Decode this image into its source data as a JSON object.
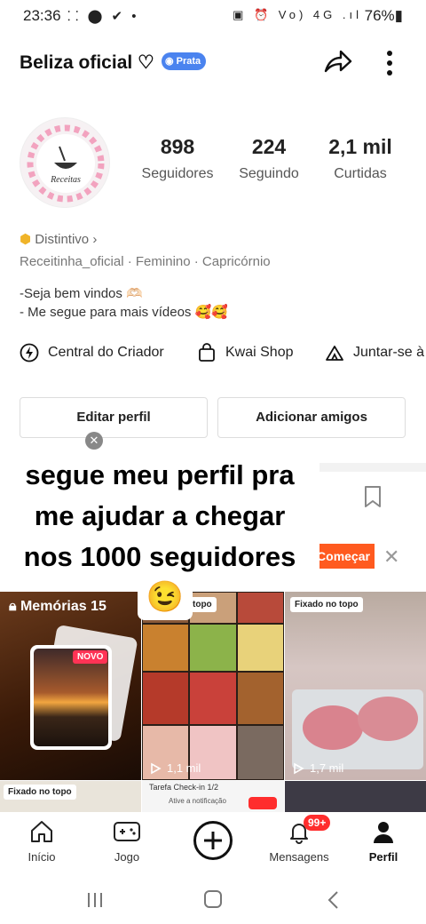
{
  "status_bar": {
    "time": "23:36",
    "left_icons": "⸬ ⬤ ✔ •",
    "right_icons": "▣ ⏰ Vo) 4G .ıl",
    "battery": "76%▮"
  },
  "header": {
    "username": "Beliza oficial ♡",
    "tier_badge": "Prata"
  },
  "avatar": {
    "label": "Receitas"
  },
  "stats": [
    {
      "value": "898",
      "label": "Seguidores"
    },
    {
      "value": "224",
      "label": "Seguindo"
    },
    {
      "value": "2,1 mil",
      "label": "Curtidas"
    }
  ],
  "profile": {
    "distintivo": "Distintivo",
    "meta": "Receitinha_oficial  ·  Feminino  ·  Capricórnio",
    "bio_line1": "-Seja bem vindos 🫶🏻",
    "bio_line2": "- Me segue para mais vídeos 🥰🥰"
  },
  "quick_links": [
    {
      "label": "Central do Criador",
      "icon": "bolt-icon"
    },
    {
      "label": "Kwai Shop",
      "icon": "shopping-bag-icon"
    },
    {
      "label": "Juntar-se à",
      "icon": "tent-icon"
    }
  ],
  "actions": {
    "edit_profile": "Editar perfil",
    "add_friends": "Adicionar amigos"
  },
  "overlay_text": {
    "line1": "segue meu perfil pra",
    "line2": "me ajudar a chegar",
    "line3": "nos 1000 seguidores"
  },
  "banner": {
    "cta": "Começar",
    "emoji": "😉"
  },
  "grid": {
    "memories_label": "Memórias 15",
    "new_badge": "NOVO",
    "tile2_tag": "topo",
    "tile2_views": "1,1 mil",
    "tile3_tag": "Fixado no topo",
    "tile3_views": "1,7 mil",
    "tile4_tag": "Fixado no topo",
    "tile5_text": "Tarefa Check-in 1/2",
    "tile5_sub": "Ative a notificação"
  },
  "bottom_nav": [
    {
      "label": "Início",
      "icon": "home-icon"
    },
    {
      "label": "Jogo",
      "icon": "gamepad-icon"
    },
    {
      "label": "",
      "icon": "plus-icon"
    },
    {
      "label": "Mensagens",
      "icon": "bell-icon"
    },
    {
      "label": "Perfil",
      "icon": "person-icon"
    }
  ],
  "notification_count": "99+",
  "colors": {
    "accent": "#ff5a1f",
    "badge_blue": "#4a83ef",
    "notification_red": "#ff2d2d"
  }
}
